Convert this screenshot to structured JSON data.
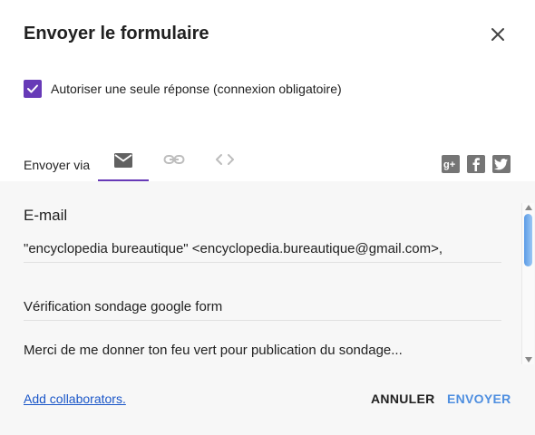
{
  "dialog": {
    "title": "Envoyer le formulaire"
  },
  "options": {
    "single_response_label": "Autoriser une seule réponse (connexion obligatoire)",
    "single_response_checked": true
  },
  "send_via": {
    "label": "Envoyer via",
    "tabs": [
      {
        "icon": "email-icon",
        "active": true
      },
      {
        "icon": "link-icon",
        "active": false
      },
      {
        "icon": "embed-code-icon",
        "active": false
      }
    ],
    "share": [
      "google-plus-icon",
      "facebook-icon",
      "twitter-icon"
    ]
  },
  "email": {
    "section_title": "E-mail",
    "to": "\"encyclopedia bureautique\" <encyclopedia.bureautique@gmail.com>,",
    "subject": "Vérification sondage google form",
    "message": "Merci de me donner ton feu vert pour publication du sondage..."
  },
  "footer": {
    "add_collaborators": "Add collaborators.",
    "cancel": "ANNULER",
    "send": "ENVOYER"
  },
  "colors": {
    "accent": "#673ab7",
    "send_button": "#4f8fe0",
    "link": "#1a56c8"
  }
}
